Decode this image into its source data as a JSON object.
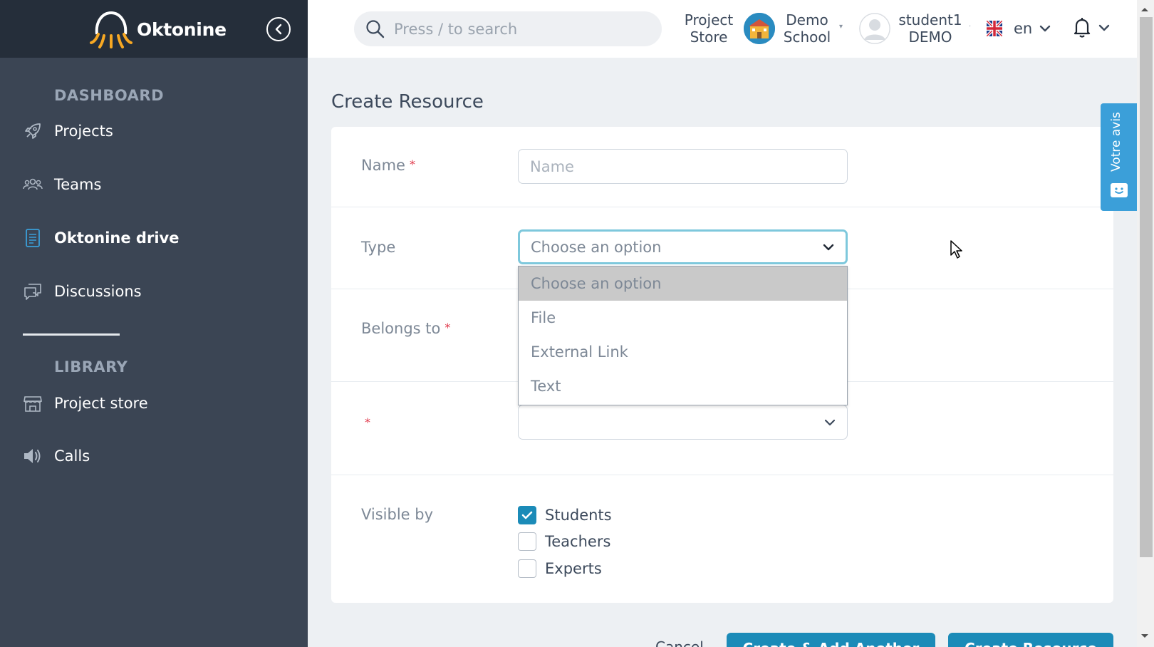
{
  "app": {
    "name": "Oktonine"
  },
  "sidebar": {
    "sections": [
      {
        "title": "DASHBOARD"
      },
      {
        "title": "LIBRARY"
      }
    ],
    "items": [
      {
        "label": "Projects",
        "icon": "rocket-icon"
      },
      {
        "label": "Teams",
        "icon": "users-icon"
      },
      {
        "label": "Oktonine drive",
        "icon": "drive-icon",
        "active": true
      },
      {
        "label": "Discussions",
        "icon": "chat-icon"
      },
      {
        "label": "Project store",
        "icon": "store-icon"
      },
      {
        "label": "Calls",
        "icon": "speaker-icon"
      }
    ]
  },
  "topbar": {
    "search_placeholder": "Press / to search",
    "project_store_line1": "Project",
    "project_store_line2": "Store",
    "school_line1": "Demo",
    "school_line2": "School",
    "user_line1": "student1",
    "user_line2": "DEMO",
    "language": "en"
  },
  "page": {
    "title": "Create Resource"
  },
  "form": {
    "name_label": "Name",
    "name_placeholder": "Name",
    "type_label": "Type",
    "type_value": "Choose an option",
    "belongs_label": "Belongs to",
    "required_mark": "*",
    "visible_label": "Visible by",
    "type_options": [
      "Choose an option",
      "File",
      "External Link",
      "Text"
    ],
    "visibility": [
      {
        "label": "Students",
        "checked": true
      },
      {
        "label": "Teachers",
        "checked": false
      },
      {
        "label": "Experts",
        "checked": false
      }
    ]
  },
  "actions": {
    "cancel": "Cancel",
    "create_add_another": "Create & Add Another",
    "create": "Create Resource"
  },
  "feedback": {
    "label": "Votre avis"
  },
  "colors": {
    "sidebar": "#3b4554",
    "sidebar_header": "#252e3a",
    "accent": "#1b8bb8",
    "feedback": "#3b9fd9",
    "required": "#e0384a"
  }
}
